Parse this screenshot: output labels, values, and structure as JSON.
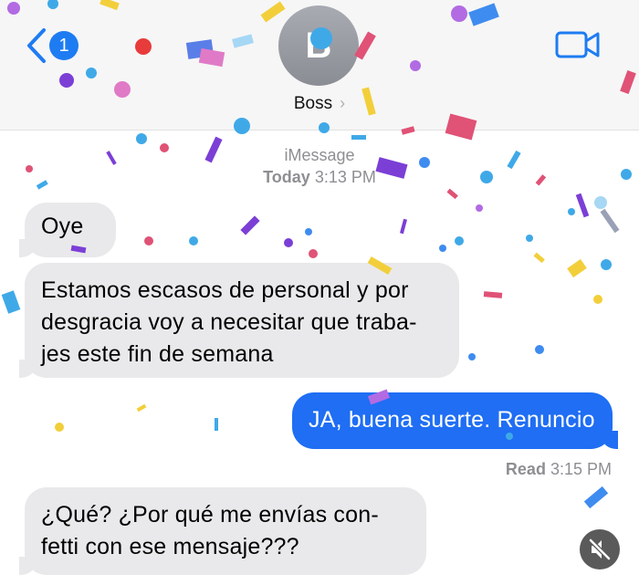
{
  "header": {
    "unread_count": "1",
    "avatar_initial": "B",
    "contact_name": "Boss",
    "chevron": "›"
  },
  "meta": {
    "service": "iMessage",
    "timestamp_day": "Today",
    "timestamp_time": "3:13 PM"
  },
  "messages": [
    {
      "direction": "incoming",
      "lines": [
        "Oye"
      ]
    },
    {
      "direction": "incoming",
      "lines": [
        "Estamos escasos de personal y por",
        "desgracia voy a necesitar que traba-",
        "jes este fin de semana"
      ]
    },
    {
      "direction": "outgoing",
      "lines": [
        "JA, buena suerte. Renuncio"
      ]
    },
    {
      "direction": "incoming",
      "lines": [
        "¿Qué? ¿Por qué me envías con-",
        "fetti con ese mensaje???"
      ]
    }
  ],
  "read_receipt": {
    "label": "Read",
    "time": "3:15 PM"
  },
  "colors": {
    "outgoing_bubble": "#1f6ef3",
    "incoming_bubble": "#e9e9eb",
    "accent": "#1e7cf2"
  },
  "icons": [
    "back-chevron-icon",
    "video-camera-icon",
    "mute-icon"
  ],
  "effect": "confetti"
}
